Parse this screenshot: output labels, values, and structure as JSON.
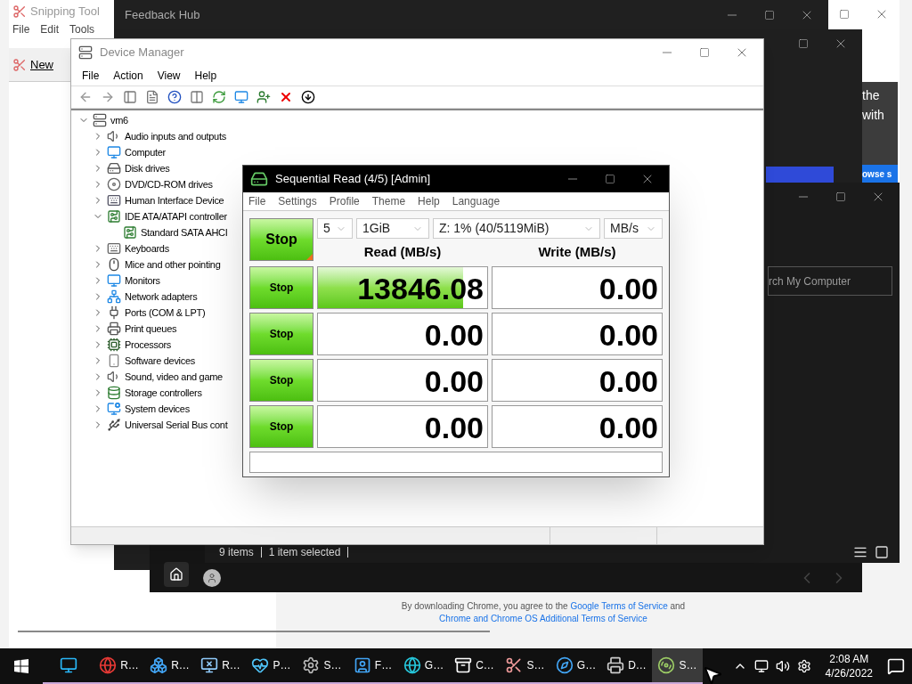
{
  "snipping_tool": {
    "title": "Snipping Tool",
    "menu": [
      "File",
      "Edit",
      "Tools"
    ],
    "new_button": "New"
  },
  "feedback_hub": {
    "title": "Feedback Hub"
  },
  "browser_peek": {
    "lines": [
      "the",
      "with"
    ],
    "button": "owse s"
  },
  "file_explorer": {
    "search_placeholder": "rch My Computer",
    "status": [
      "9 items",
      "1 item selected"
    ]
  },
  "chrome": {
    "terms": {
      "before": "By downloading Chrome, you agree to the",
      "link_1": "Google Terms of Service",
      "middle": "and",
      "link_2": "Chrome and Chrome OS Additional Terms of Service"
    }
  },
  "device_manager": {
    "title": "Device Manager",
    "menu": [
      "File",
      "Action",
      "View",
      "Help"
    ],
    "tree": {
      "label": "vm6",
      "expanded": true,
      "children": [
        {
          "label": "Audio inputs and outputs",
          "expanded": false
        },
        {
          "label": "Computer",
          "expanded": false
        },
        {
          "label": "Disk drives",
          "expanded": false
        },
        {
          "label": "DVD/CD-ROM drives",
          "expanded": false
        },
        {
          "label": "Human Interface Device",
          "expanded": false
        },
        {
          "label": "IDE ATA/ATAPI controller",
          "expanded": true,
          "children": [
            {
              "label": "Standard SATA AHCI"
            }
          ]
        },
        {
          "label": "Keyboards",
          "expanded": false
        },
        {
          "label": "Mice and other pointing",
          "expanded": false
        },
        {
          "label": "Monitors",
          "expanded": false
        },
        {
          "label": "Network adapters",
          "expanded": false
        },
        {
          "label": "Ports (COM & LPT)",
          "expanded": false
        },
        {
          "label": "Print queues",
          "expanded": false
        },
        {
          "label": "Processors",
          "expanded": false
        },
        {
          "label": "Software devices",
          "expanded": false
        },
        {
          "label": "Sound, video and game",
          "expanded": false
        },
        {
          "label": "Storage controllers",
          "expanded": false
        },
        {
          "label": "System devices",
          "expanded": false
        },
        {
          "label": "Universal Serial Bus cont",
          "expanded": false
        }
      ]
    }
  },
  "disk_mark": {
    "title": "Sequential Read (4/5) [Admin]",
    "menu": [
      "File",
      "Settings",
      "Profile",
      "Theme",
      "Help",
      "Language"
    ],
    "main_button": "Stop",
    "selects": [
      "5",
      "1GiB",
      "Z: 1% (40/5119MiB)",
      "MB/s"
    ],
    "headers": [
      "Read (MB/s)",
      "Write (MB/s)"
    ],
    "rows": [
      {
        "button": "Stop",
        "read": {
          "value": "13846.08",
          "level": 0.86
        },
        "write": {
          "value": "0.00"
        }
      },
      {
        "button": "Stop",
        "read": {
          "value": "0.00"
        },
        "write": {
          "value": "0.00"
        }
      },
      {
        "button": "Stop",
        "read": {
          "value": "0.00"
        },
        "write": {
          "value": "0.00"
        }
      },
      {
        "button": "Stop",
        "read": {
          "value": "0.00"
        },
        "write": {
          "value": "0.00"
        }
      }
    ]
  },
  "taskbar": {
    "items": [
      {
        "selected": false
      },
      {
        "label": "R…",
        "selected": false
      },
      {
        "label": "R…",
        "selected": false
      },
      {
        "label": "R…",
        "selected": false
      },
      {
        "label": "P…",
        "selected": false
      },
      {
        "label": "S…",
        "selected": false
      },
      {
        "label": "F…",
        "selected": false
      },
      {
        "label": "G…",
        "selected": false
      },
      {
        "label": "C…",
        "selected": false
      },
      {
        "label": "S…",
        "selected": false
      },
      {
        "label": "G…",
        "selected": false
      },
      {
        "label": "D…",
        "selected": false
      },
      {
        "label": "S…",
        "selected": true
      }
    ],
    "time": "2:08 AM",
    "date": "4/26/2022"
  }
}
